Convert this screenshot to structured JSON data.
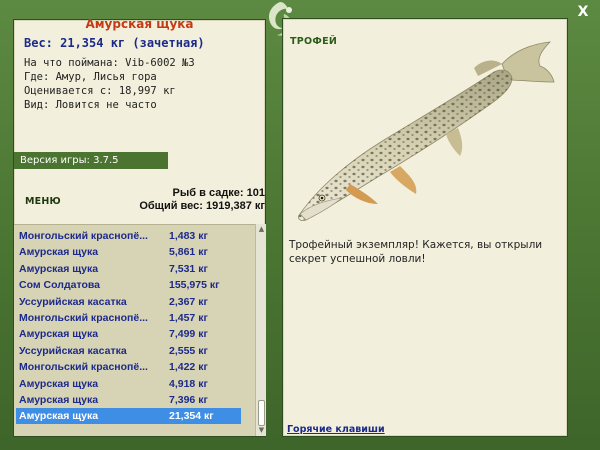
{
  "fish": {
    "title": "Амурская щука",
    "weight": "Вес: 21,354 кг (зачетная)",
    "bait": "На что поймана: Vib-6002 №3",
    "place": "Где: Амур, Лисья гора",
    "value": "Оценивается с: 18,997 кг",
    "rarity": "Вид: Ловится не часто"
  },
  "version": "Версия игры: 3.7.5",
  "menu_label": "МЕНЮ",
  "stats": {
    "fish_count": "Рыб в садке: 101",
    "total_weight": "Общий вес: 1919,387 кг"
  },
  "catches": [
    {
      "name": "Монгольский краснопё...",
      "weight": "1,483 кг"
    },
    {
      "name": "Амурская щука",
      "weight": "5,861 кг"
    },
    {
      "name": "Амурская щука",
      "weight": "7,531 кг"
    },
    {
      "name": "Сом Солдатова",
      "weight": "155,975 кг"
    },
    {
      "name": "Уссурийская касатка",
      "weight": "2,367 кг"
    },
    {
      "name": "Монгольский краснопё...",
      "weight": "1,457 кг"
    },
    {
      "name": "Амурская щука",
      "weight": "7,499 кг"
    },
    {
      "name": "Уссурийская касатка",
      "weight": "2,555 кг"
    },
    {
      "name": "Монгольский краснопё...",
      "weight": "1,422 кг"
    },
    {
      "name": "Амурская щука",
      "weight": "4,918 кг"
    },
    {
      "name": "Амурская щука",
      "weight": "7,396 кг"
    },
    {
      "name": "Амурская щука",
      "weight": "21,354 кг"
    }
  ],
  "selected_index": 11,
  "trophy_label": "ТРОФЕЙ",
  "trophy_text": "Трофейный экземпляр! Кажется, вы открыли секрет успешной ловли!",
  "hotkeys_label": "Горячие клавиши",
  "close_label": "X",
  "colors": {
    "frame": "#4e7a36",
    "panel": "#f2f0dc",
    "title_red": "#c23b16",
    "text_blue": "#1c2a8a",
    "selection": "#3f8ee6"
  }
}
